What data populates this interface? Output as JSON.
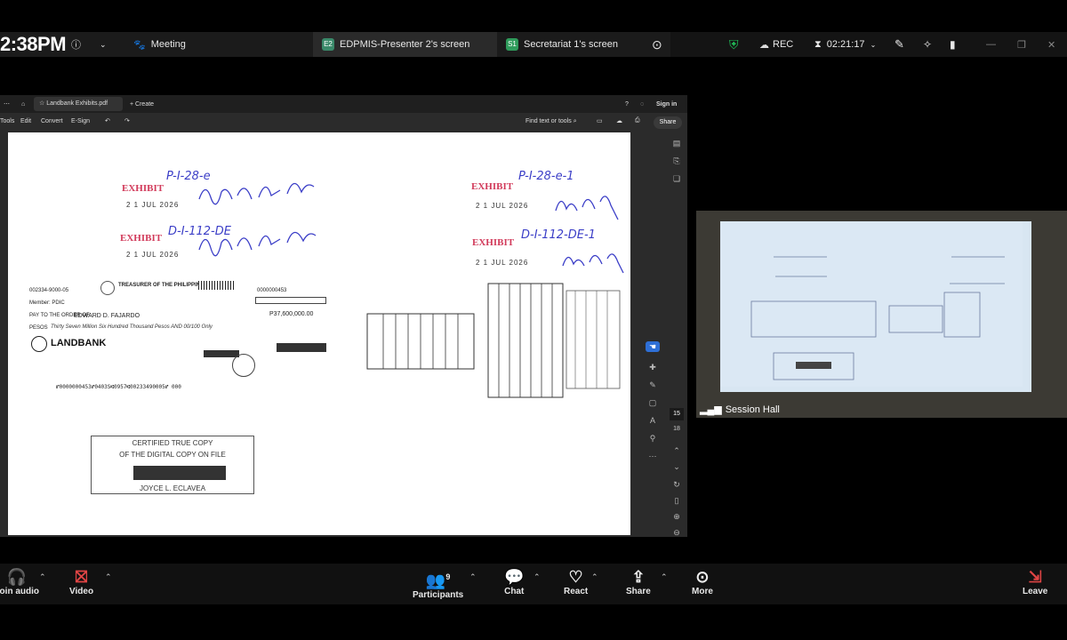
{
  "topbar": {
    "time": "2:38PM",
    "meeting_label": "Meeting",
    "tabs": [
      {
        "badge": "E2",
        "label": "EDPMIS-Presenter 2's screen"
      },
      {
        "badge": "S1",
        "label": "Secretariat 1's screen"
      }
    ],
    "rec_label": "REC",
    "timer": "02:21:17"
  },
  "pdf": {
    "tab_title": "Landbank Exhibits.pdf",
    "create_label": "Create",
    "sign_in": "Sign in",
    "menu": [
      "Tools",
      "Edit",
      "Convert",
      "E-Sign"
    ],
    "find_placeholder": "Find text or tools",
    "share_label": "Share",
    "page_number": "15",
    "page_total": "18"
  },
  "document": {
    "exhibit_label": "EXHIBIT",
    "exhibits_left": [
      "P-I-28-e",
      "D-I-112-DE"
    ],
    "exhibits_right": [
      "P-I-28-e-1",
      "D-I-112-DE-1"
    ],
    "stamp_date": "2 1 JUL 2026",
    "check": {
      "account": "002334-9000-05",
      "issuer": "TREASURER OF THE PHILIPPINES",
      "serial": "0000000453",
      "member": "Member: PDIC",
      "payee": "EDWARD D. FAJARDO",
      "amount": "P37,600,000.00",
      "amount_words": "Thirty Seven Million Six Hundred Thousand Pesos AND 00/100 Only",
      "bank": "LANDBANK",
      "micr": "⑈0000000453⑈0403S⑆0957⑆00233490005⑈ 000"
    },
    "certified_line1": "CERTIFIED TRUE COPY",
    "certified_line2": "OF THE DIGITAL COPY ON FILE",
    "certified_name": "JOYCE L. ECLAVEA"
  },
  "hall": {
    "label": "Session Hall"
  },
  "bottombar": {
    "join_audio": "Join audio",
    "video": "Video",
    "participants": "Participants",
    "participants_count": "9",
    "chat": "Chat",
    "react": "React",
    "share": "Share",
    "more": "More",
    "leave": "Leave"
  }
}
